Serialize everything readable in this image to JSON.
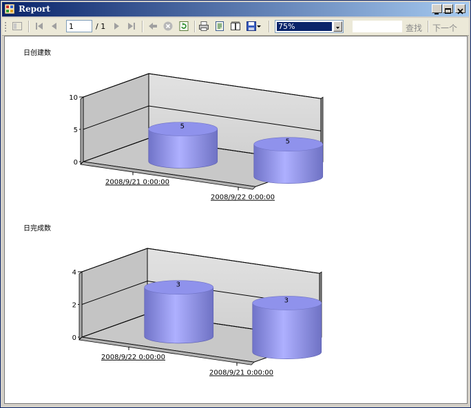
{
  "window": {
    "title": "Report"
  },
  "toolbar": {
    "page_value": "1",
    "page_of": "/ 1",
    "zoom_value": "75%",
    "find_label": "查找",
    "next_label": "下一个"
  },
  "colors": {
    "titlebar": "#0a246a",
    "cylinder": "#8c8ee0",
    "wall": "#d6d6d6"
  },
  "report": {
    "section1_title": "日创建数",
    "section2_title": "日完成数"
  },
  "chart_data": [
    {
      "type": "bar",
      "title": "日创建数",
      "categories": [
        "2008/9/21 0:00:00",
        "2008/9/22 0:00:00"
      ],
      "values": [
        5,
        5
      ],
      "ylim": [
        0,
        10
      ],
      "yticks": [
        "0",
        "5",
        "10"
      ],
      "data_labels": [
        "5",
        "5"
      ]
    },
    {
      "type": "bar",
      "title": "日完成数",
      "categories": [
        "2008/9/22 0:00:00",
        "2008/9/21 0:00:00"
      ],
      "values": [
        3,
        3
      ],
      "ylim": [
        0,
        4
      ],
      "yticks": [
        "0",
        "2",
        "4"
      ],
      "data_labels": [
        "3",
        "3"
      ]
    }
  ]
}
